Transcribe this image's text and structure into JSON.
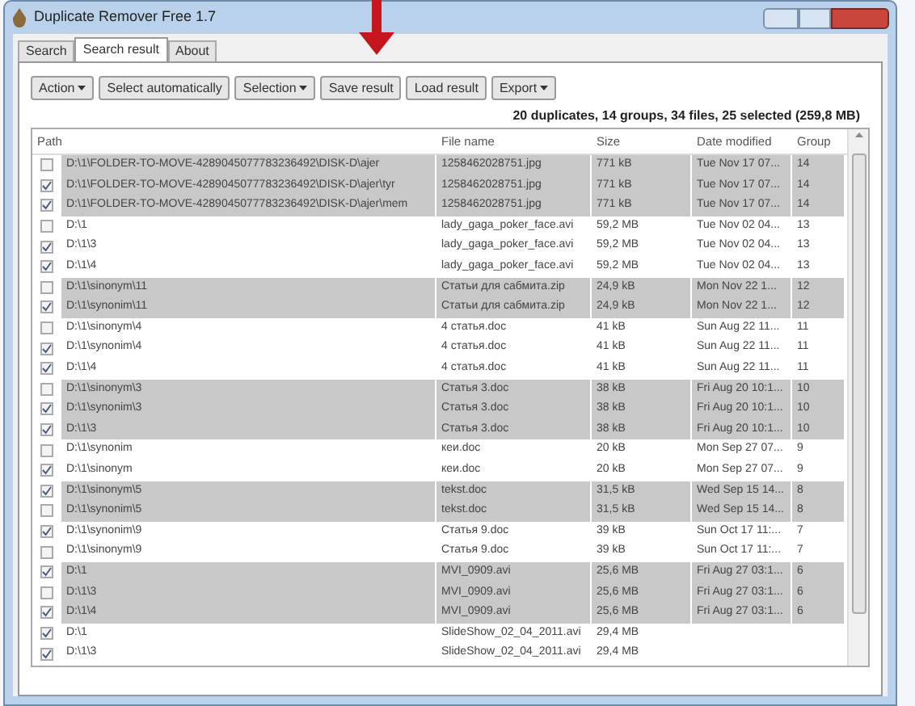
{
  "window": {
    "title": "Duplicate Remover Free 1.7"
  },
  "tabs": [
    {
      "label": "Search",
      "selected": false
    },
    {
      "label": "Search result",
      "selected": true
    },
    {
      "label": "About",
      "selected": false
    }
  ],
  "toolbar": [
    {
      "label": "Action",
      "dropdown": true
    },
    {
      "label": "Select automatically",
      "dropdown": false
    },
    {
      "label": "Selection",
      "dropdown": true
    },
    {
      "label": "Save result",
      "dropdown": false
    },
    {
      "label": "Load result",
      "dropdown": false
    },
    {
      "label": "Export",
      "dropdown": true
    }
  ],
  "summary": "20 duplicates, 14 groups, 34 files, 25 selected (259,8 MB)",
  "table": {
    "columns": [
      "Path",
      "File name",
      "Size",
      "Date modified",
      "Group"
    ],
    "rows": [
      {
        "checked": false,
        "highlighted": true,
        "cells": [
          "D:\\1\\FOLDER-TO-MOVE-4289045077783236492\\DISK-D\\ajer",
          "1258462028751.jpg",
          "771 kB",
          "Tue Nov 17 07...",
          "14"
        ]
      },
      {
        "checked": true,
        "highlighted": true,
        "cells": [
          "D:\\1\\FOLDER-TO-MOVE-4289045077783236492\\DISK-D\\ajer\\tyr",
          "1258462028751.jpg",
          "771 kB",
          "Tue Nov 17 07...",
          "14"
        ]
      },
      {
        "checked": true,
        "highlighted": true,
        "cells": [
          "D:\\1\\FOLDER-TO-MOVE-4289045077783236492\\DISK-D\\ajer\\mem",
          "1258462028751.jpg",
          "771 kB",
          "Tue Nov 17 07...",
          "14"
        ]
      },
      {
        "checked": false,
        "highlighted": false,
        "cells": [
          "D:\\1",
          "lady_gaga_poker_face.avi",
          "59,2 MB",
          "Tue Nov 02 04...",
          "13"
        ]
      },
      {
        "checked": true,
        "highlighted": false,
        "cells": [
          "D:\\1\\3",
          "lady_gaga_poker_face.avi",
          "59,2 MB",
          "Tue Nov 02 04...",
          "13"
        ]
      },
      {
        "checked": true,
        "highlighted": false,
        "cells": [
          "D:\\1\\4",
          "lady_gaga_poker_face.avi",
          "59,2 MB",
          "Tue Nov 02 04...",
          "13"
        ]
      },
      {
        "checked": false,
        "highlighted": true,
        "cells": [
          "D:\\1\\sinonym\\11",
          "Статьи для сабмита.zip",
          "24,9 kB",
          "Mon Nov 22 1...",
          "12"
        ]
      },
      {
        "checked": true,
        "highlighted": true,
        "cells": [
          "D:\\1\\synonim\\11",
          "Статьи для сабмита.zip",
          "24,9 kB",
          "Mon Nov 22 1...",
          "12"
        ]
      },
      {
        "checked": false,
        "highlighted": false,
        "cells": [
          "D:\\1\\sinonym\\4",
          "4 статья.doc",
          "41 kB",
          "Sun Aug 22 11...",
          "11"
        ]
      },
      {
        "checked": true,
        "highlighted": false,
        "cells": [
          "D:\\1\\synonim\\4",
          "4 статья.doc",
          "41 kB",
          "Sun Aug 22 11...",
          "11"
        ]
      },
      {
        "checked": true,
        "highlighted": false,
        "cells": [
          "D:\\1\\4",
          "4 статья.doc",
          "41 kB",
          "Sun Aug 22 11...",
          "11"
        ]
      },
      {
        "checked": false,
        "highlighted": true,
        "cells": [
          "D:\\1\\sinonym\\3",
          "Статья 3.doc",
          "38 kB",
          "Fri Aug 20 10:1...",
          "10"
        ]
      },
      {
        "checked": true,
        "highlighted": true,
        "cells": [
          "D:\\1\\synonim\\3",
          "Статья 3.doc",
          "38 kB",
          "Fri Aug 20 10:1...",
          "10"
        ]
      },
      {
        "checked": true,
        "highlighted": true,
        "cells": [
          "D:\\1\\3",
          "Статья 3.doc",
          "38 kB",
          "Fri Aug 20 10:1...",
          "10"
        ]
      },
      {
        "checked": false,
        "highlighted": false,
        "cells": [
          "D:\\1\\synonim",
          "кеи.doc",
          "20 kB",
          "Mon Sep 27 07...",
          "9"
        ]
      },
      {
        "checked": true,
        "highlighted": false,
        "cells": [
          "D:\\1\\sinonym",
          "кеи.doc",
          "20 kB",
          "Mon Sep 27 07...",
          "9"
        ]
      },
      {
        "checked": true,
        "highlighted": true,
        "cells": [
          "D:\\1\\sinonym\\5",
          "tekst.doc",
          "31,5 kB",
          "Wed Sep 15 14...",
          "8"
        ]
      },
      {
        "checked": false,
        "highlighted": true,
        "cells": [
          "D:\\1\\synonim\\5",
          "tekst.doc",
          "31,5 kB",
          "Wed Sep 15 14...",
          "8"
        ]
      },
      {
        "checked": true,
        "highlighted": false,
        "cells": [
          "D:\\1\\synonim\\9",
          "Статья 9.doc",
          "39 kB",
          "Sun Oct 17 11:...",
          "7"
        ]
      },
      {
        "checked": false,
        "highlighted": false,
        "cells": [
          "D:\\1\\sinonym\\9",
          "Статья 9.doc",
          "39 kB",
          "Sun Oct 17 11:...",
          "7"
        ]
      },
      {
        "checked": true,
        "highlighted": true,
        "cells": [
          "D:\\1",
          "MVI_0909.avi",
          "25,6 MB",
          "Fri Aug 27 03:1...",
          "6"
        ]
      },
      {
        "checked": false,
        "highlighted": true,
        "cells": [
          "D:\\1\\3",
          "MVI_0909.avi",
          "25,6 MB",
          "Fri Aug 27 03:1...",
          "6"
        ]
      },
      {
        "checked": true,
        "highlighted": true,
        "cells": [
          "D:\\1\\4",
          "MVI_0909.avi",
          "25,6 MB",
          "Fri Aug 27 03:1...",
          "6"
        ]
      },
      {
        "checked": true,
        "highlighted": false,
        "cells": [
          "D:\\1",
          "SlideShow_02_04_2011.avi",
          "29,4 MB"
        ]
      },
      {
        "checked": true,
        "highlighted": false,
        "cells": [
          "D:\\1\\3",
          "SlideShow_02_04_2011.avi",
          "29,4 MB"
        ]
      }
    ]
  }
}
